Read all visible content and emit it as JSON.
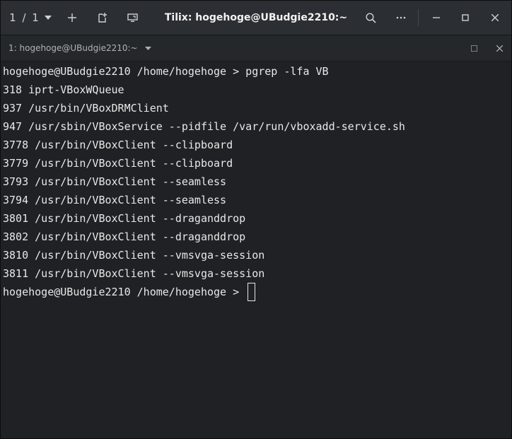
{
  "header": {
    "session_count": "1 / 1",
    "title": "Tilix: hogehoge@UBudgie2210:~"
  },
  "terminal_tab": {
    "title": "1: hogehoge@UBudgie2210:~"
  },
  "terminal": {
    "lines": [
      "hogehoge@UBudgie2210 /home/hogehoge > pgrep -lfa VB",
      "318 iprt-VBoxWQueue",
      "937 /usr/bin/VBoxDRMClient",
      "947 /usr/sbin/VBoxService --pidfile /var/run/vboxadd-service.sh",
      "3778 /usr/bin/VBoxClient --clipboard",
      "3779 /usr/bin/VBoxClient --clipboard",
      "3793 /usr/bin/VBoxClient --seamless",
      "3794 /usr/bin/VBoxClient --seamless",
      "3801 /usr/bin/VBoxClient --draganddrop",
      "3802 /usr/bin/VBoxClient --draganddrop",
      "3810 /usr/bin/VBoxClient --vmsvga-session",
      "3811 /usr/bin/VBoxClient --vmsvga-session"
    ],
    "prompt": "hogehoge@UBudgie2210 /home/hogehoge > "
  },
  "icons": {
    "session_menu": "chevron-down-icon",
    "add_terminal": "plus-icon",
    "add_session": "new-tab-icon",
    "sync_input": "monitor-icon",
    "search": "search-icon",
    "menu": "ellipsis-icon",
    "minimize": "minimize-icon",
    "maximize": "maximize-icon",
    "close": "close-icon"
  }
}
